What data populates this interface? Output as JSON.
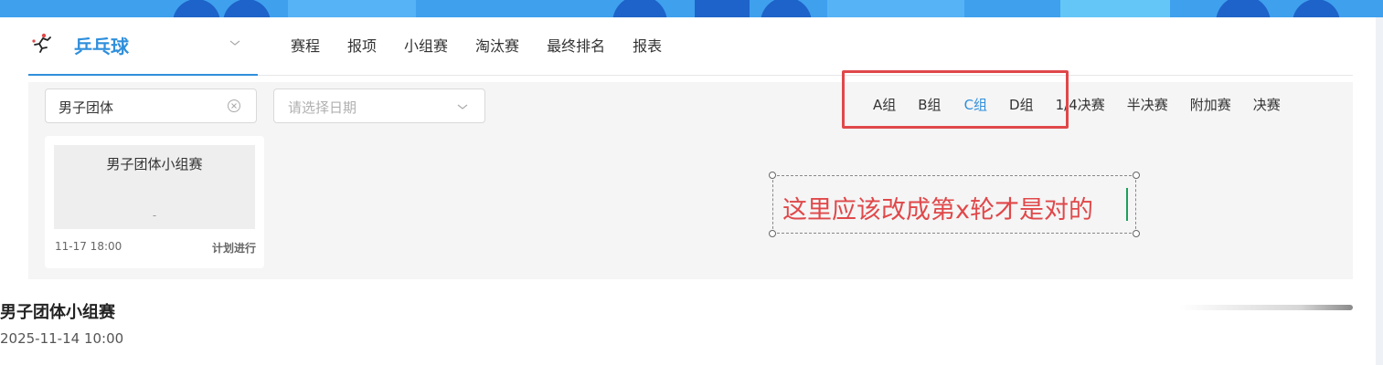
{
  "sport": {
    "name": "乒乓球",
    "icon": "table-tennis-player-icon"
  },
  "tabs": [
    "赛程",
    "报项",
    "小组赛",
    "淘汰赛",
    "最终排名",
    "报表"
  ],
  "filters": {
    "event_value": "男子团体",
    "date_placeholder": "请选择日期"
  },
  "groups": [
    {
      "label": "A组",
      "active": false
    },
    {
      "label": "B组",
      "active": false
    },
    {
      "label": "C组",
      "active": true
    },
    {
      "label": "D组",
      "active": false
    },
    {
      "label": "1/4决赛",
      "active": false
    },
    {
      "label": "半决赛",
      "active": false
    },
    {
      "label": "附加赛",
      "active": false
    },
    {
      "label": "决赛",
      "active": false
    }
  ],
  "match_card": {
    "title": "男子团体小组赛",
    "score": "-",
    "time": "11-17 18:00",
    "status": "计划进行"
  },
  "annotation": {
    "text": "这里应该改成第x轮才是对的",
    "color": "#e0484a"
  },
  "section": {
    "title": "男子团体小组赛",
    "date": "2025-11-14 10:00"
  },
  "colors": {
    "accent": "#2f8fdc",
    "highlight": "#e0484a",
    "banner": "#3fa0ee"
  }
}
